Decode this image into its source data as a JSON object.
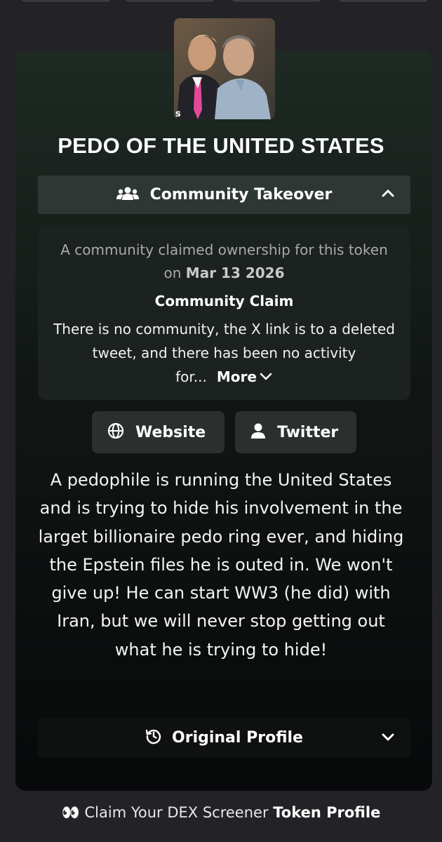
{
  "title": "PEDO OF THE UNITED STATES",
  "community_takeover": {
    "header_label": "Community Takeover",
    "intro_text": "A community claimed ownership for this token on ",
    "intro_date": "Mar 13 2026",
    "claim_title": "Community Claim",
    "claim_text": "There is no community, the X link is to a deleted tweet, and there has been no activity for...",
    "more_label": "More"
  },
  "links": {
    "website_label": "Website",
    "twitter_label": "Twitter"
  },
  "description": "A pedophile is running the United States and is trying to hide his involvement in the larget billionaire pedo ring ever, and hiding the Epstein files he is outed in. We won't give up! He can start WW3 (he did) with Iran, but we will never stop getting out what he is trying to hide!",
  "original_profile": {
    "label": "Original Profile"
  },
  "footer": {
    "eyes_emoji": "👀",
    "text": "Claim Your DEX Screener ",
    "bold": "Token Profile"
  },
  "icons": {
    "community": "users-icon",
    "chevron_up": "chevron-up-icon",
    "chevron_down": "chevron-down-icon",
    "website": "globe-icon",
    "twitter": "user-icon",
    "history": "history-icon"
  }
}
